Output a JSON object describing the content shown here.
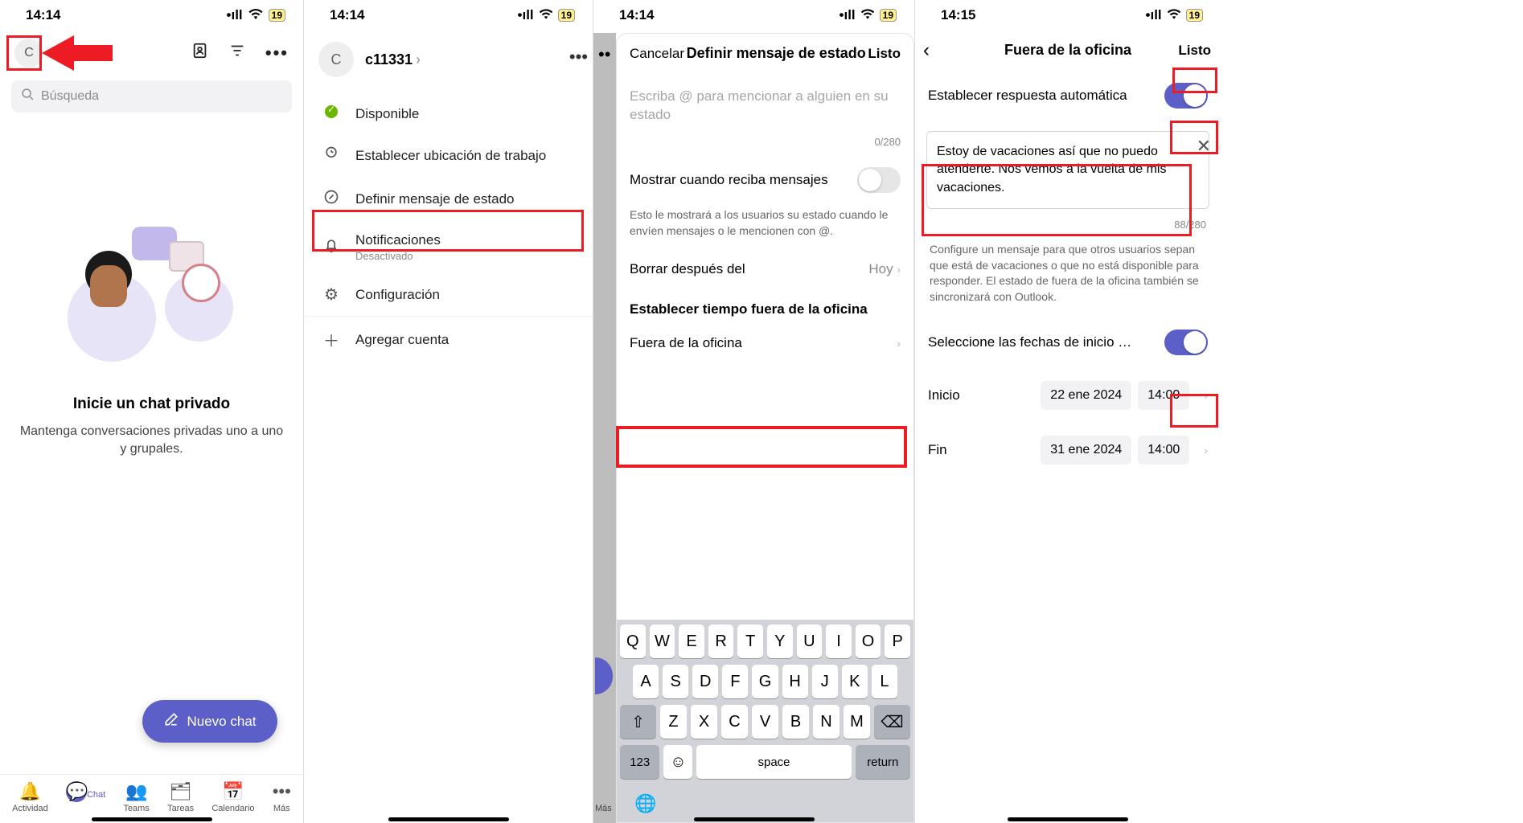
{
  "status": {
    "time1": "14:14",
    "time2": "14:14",
    "time3": "14:14",
    "time4": "14:15",
    "battery": "19"
  },
  "s1": {
    "avatar": "C",
    "search_ph": "Búsqueda",
    "empty_title": "Inicie un chat privado",
    "empty_body": "Mantenga conversaciones privadas uno a uno y grupales.",
    "new_chat": "Nuevo chat",
    "tabs": {
      "activity": "Actividad",
      "chat": "Chat",
      "teams": "Teams",
      "tasks": "Tareas",
      "calendar": "Calendario",
      "more": "Más"
    }
  },
  "s2": {
    "user": "c11331",
    "items": {
      "available": "Disponible",
      "location": "Establecer ubicación de trabajo",
      "status_msg": "Definir mensaje de estado",
      "notifications": "Notificaciones",
      "notif_sub": "Desactivado",
      "settings": "Configuración",
      "add_account": "Agregar cuenta"
    }
  },
  "s3": {
    "cancel": "Cancelar",
    "title": "Definir mensaje de estado",
    "done": "Listo",
    "placeholder": "Escriba @ para mencionar a alguien en su estado",
    "count": "0/280",
    "show_when": "Mostrar cuando reciba mensajes",
    "note": "Esto le mostrará a los usuarios su estado cuando le envíen mensajes o le mencionen con @.",
    "clear_after": "Borrar después del",
    "clear_val": "Hoy",
    "section": "Establecer tiempo fuera de la oficina",
    "oof": "Fuera de la oficina",
    "kb_space": "space",
    "kb_return": "return",
    "kb_123": "123",
    "tab_more": "Más"
  },
  "s4": {
    "title": "Fuera de la oficina",
    "done": "Listo",
    "auto_reply": "Establecer respuesta automática",
    "msg": "Estoy de vacaciones así que no puedo atenderte. Nos vemos a la vuelta de mis vacaciones.",
    "count": "88/280",
    "note": "Configure un mensaje para que otros usuarios sepan que está de vacaciones o que no está disponible para responder. El estado de fuera de la oficina también se sincronizará con Outlook.",
    "select_dates": "Seleccione las fechas de inicio y fina...",
    "start": "Inicio",
    "start_date": "22 ene 2024",
    "start_time": "14:00",
    "end": "Fin",
    "end_date": "31 ene 2024",
    "end_time": "14:00"
  }
}
